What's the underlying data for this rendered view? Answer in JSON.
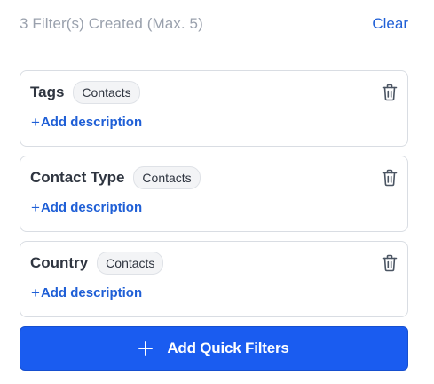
{
  "header": {
    "title": "3 Filter(s) Created (Max. 5)",
    "clear_label": "Clear"
  },
  "filters": [
    {
      "name": "Tags",
      "chip": "Contacts",
      "add_description": "Add description",
      "delete_icon": "trash-icon"
    },
    {
      "name": "Contact Type",
      "chip": "Contacts",
      "add_description": "Add description",
      "delete_icon": "trash-icon"
    },
    {
      "name": "Country",
      "chip": "Contacts",
      "add_description": "Add description",
      "delete_icon": "trash-icon"
    }
  ],
  "add_button": {
    "label": "Add Quick Filters",
    "icon": "plus-icon"
  },
  "colors": {
    "accent": "#1a5cf0",
    "link": "#1f5fd6",
    "muted_text": "#9aa1ad",
    "border": "#d9dde3"
  }
}
